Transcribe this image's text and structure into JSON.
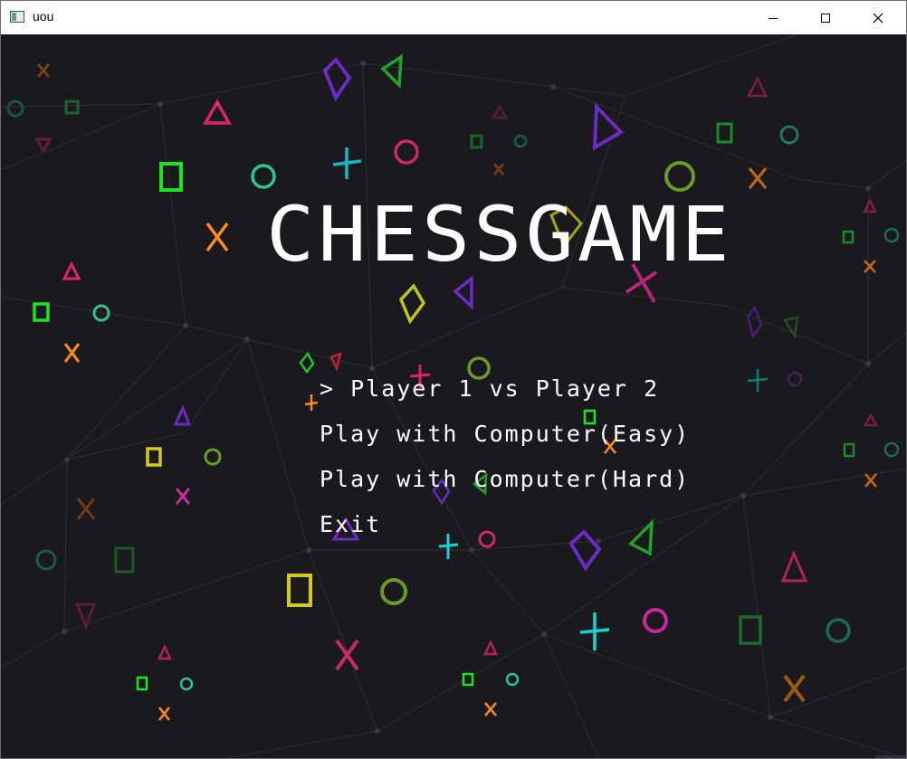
{
  "window": {
    "title": "uou",
    "controls": [
      "minimize-icon",
      "maximize-icon",
      "close-icon"
    ]
  },
  "game": {
    "title": "CHESSGAME",
    "menu": [
      {
        "label": "> Player 1 vs Player 2",
        "selected": true
      },
      {
        "label": "Play with Computer(Easy)",
        "selected": false
      },
      {
        "label": "Play with Computer(Hard)",
        "selected": false
      },
      {
        "label": "Exit",
        "selected": false
      }
    ]
  },
  "colors": {
    "background": "#1a1a1e",
    "text": "#ffffff",
    "shapes": [
      "#e0246a",
      "#6b2bc4",
      "#2ec48f",
      "#17d4d4",
      "#ff8c1a",
      "#a6c219",
      "#17e51c",
      "#d4cc12",
      "#c92a9a"
    ]
  }
}
